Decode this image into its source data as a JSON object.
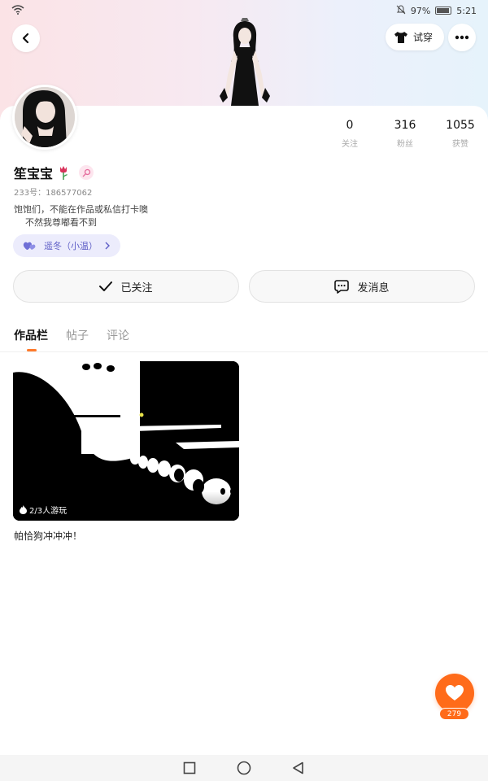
{
  "status_bar": {
    "battery": "97%",
    "time": "5:21"
  },
  "header": {
    "try_label": "试穿"
  },
  "profile": {
    "stats": [
      {
        "value": "0",
        "label": "关注"
      },
      {
        "value": "316",
        "label": "粉丝"
      },
      {
        "value": "1055",
        "label": "获赞"
      }
    ],
    "username": "笙宝宝",
    "uid": "233号：186577062",
    "bio_line1": "饱饱们，不能在作品或私信打卡噢",
    "bio_line2": "不然我尊嘟看不到",
    "tag": "遥冬（小温）",
    "follow_label": "已关注",
    "message_label": "发消息"
  },
  "tabs": [
    {
      "label": "作品栏",
      "active": true
    },
    {
      "label": "帖子",
      "active": false
    },
    {
      "label": "评论",
      "active": false
    }
  ],
  "works": [
    {
      "plays": "2/3人游玩",
      "title": "帕恰狗冲冲冲！"
    }
  ],
  "like": {
    "count": "279"
  },
  "colors": {
    "accent": "#ff6b1a",
    "tag_purple": "#5f5fc7"
  }
}
